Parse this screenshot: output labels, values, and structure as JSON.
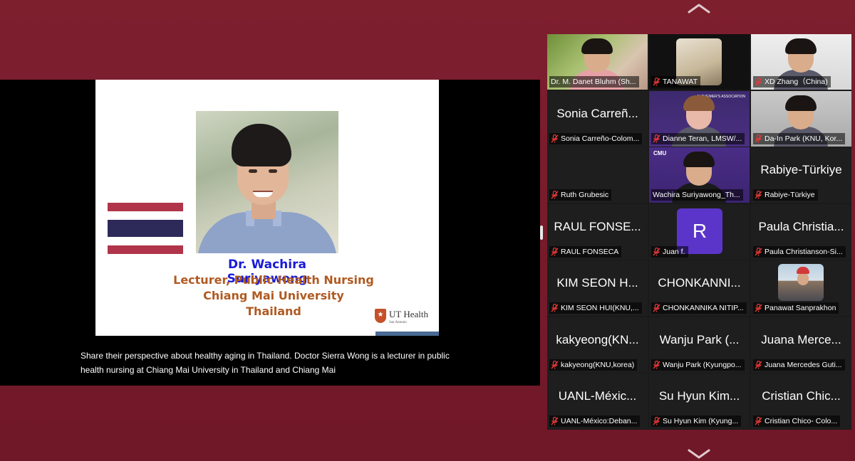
{
  "slide": {
    "name": "Dr. Wachira Suriyawong",
    "line1": "Lecturer, Public Health Nursing",
    "line2": "Chiang Mai University",
    "line3": "Thailand",
    "logo_text": "UT Health",
    "logo_sub": "San Antonio"
  },
  "caption": "Share their perspective about healthy aging in Thailand. Doctor Sierra Wong is a lecturer in public health nursing at Chiang Mai University in Thailand and Chiang Mai",
  "gallery": {
    "participants": [
      {
        "display": "",
        "nameplate": "Dr. M. Danet Bluhm (Sh...",
        "muted": false,
        "video": true,
        "active": true
      },
      {
        "display": "",
        "nameplate": "TANAWAT",
        "muted": true,
        "video": true
      },
      {
        "display": "",
        "nameplate": "XD Zhang（China)",
        "muted": true,
        "video": true
      },
      {
        "display": "Sonia Carreñ...",
        "nameplate": "Sonia Carreño-Colom...",
        "muted": true,
        "video": false
      },
      {
        "display": "",
        "nameplate": "Dianne Teran, LMSW/...",
        "muted": true,
        "video": true
      },
      {
        "display": "",
        "nameplate": "Da-In Park (KNU, Kor...",
        "muted": true,
        "video": true
      },
      {
        "display": "",
        "nameplate": "Ruth Grubesic",
        "muted": true,
        "video": false
      },
      {
        "display": "",
        "nameplate": "Wachira Suriyawong_Th...",
        "muted": false,
        "video": true
      },
      {
        "display": "Rabiye-Türkiye",
        "nameplate": "Rabiye-Türkiye",
        "muted": true,
        "video": false
      },
      {
        "display": "RAUL FONSE...",
        "nameplate": "RAUL FONSECA",
        "muted": true,
        "video": false
      },
      {
        "display": "R",
        "nameplate": "Juan f.",
        "muted": true,
        "video": false
      },
      {
        "display": "Paula Christia...",
        "nameplate": "Paula Christianson-Si...",
        "muted": true,
        "video": false
      },
      {
        "display": "KIM SEON H...",
        "nameplate": "KIM SEON HUI(KNU,...",
        "muted": true,
        "video": false
      },
      {
        "display": "CHONKANNI...",
        "nameplate": "CHONKANNIKA NITIP...",
        "muted": true,
        "video": false
      },
      {
        "display": "",
        "nameplate": "Panawat Sanprakhon",
        "muted": true,
        "video": false
      },
      {
        "display": "kakyeong(KN...",
        "nameplate": "kakyeong(KNU,korea)",
        "muted": true,
        "video": false
      },
      {
        "display": "Wanju Park (...",
        "nameplate": "Wanju Park (Kyungpo...",
        "muted": true,
        "video": false
      },
      {
        "display": "Juana Merce...",
        "nameplate": "Juana Mercedes Guti...",
        "muted": true,
        "video": false
      },
      {
        "display": "UANL-Méxic...",
        "nameplate": "UANL-México:Deban...",
        "muted": true,
        "video": false
      },
      {
        "display": "Su Hyun Kim...",
        "nameplate": "Su Hyun Kim (Kyung...",
        "muted": true,
        "video": false
      },
      {
        "display": "Cristian Chic...",
        "nameplate": "Cristian Chico- Colo...",
        "muted": true,
        "video": false
      }
    ],
    "alz_banner": "ALZHEIMER'S ASSOCIATION",
    "cmu_banner": "CMU"
  },
  "colors": {
    "background": "#7a1c2c",
    "active_speaker": "#38c758",
    "muted_icon": "#e53935",
    "avatar": "#5b34c9",
    "slide_name": "#1a1ad8",
    "slide_title": "#b05a22"
  },
  "icons": [
    "chevron-up-icon",
    "chevron-down-icon",
    "muted-mic-icon",
    "ut-health-logo"
  ]
}
